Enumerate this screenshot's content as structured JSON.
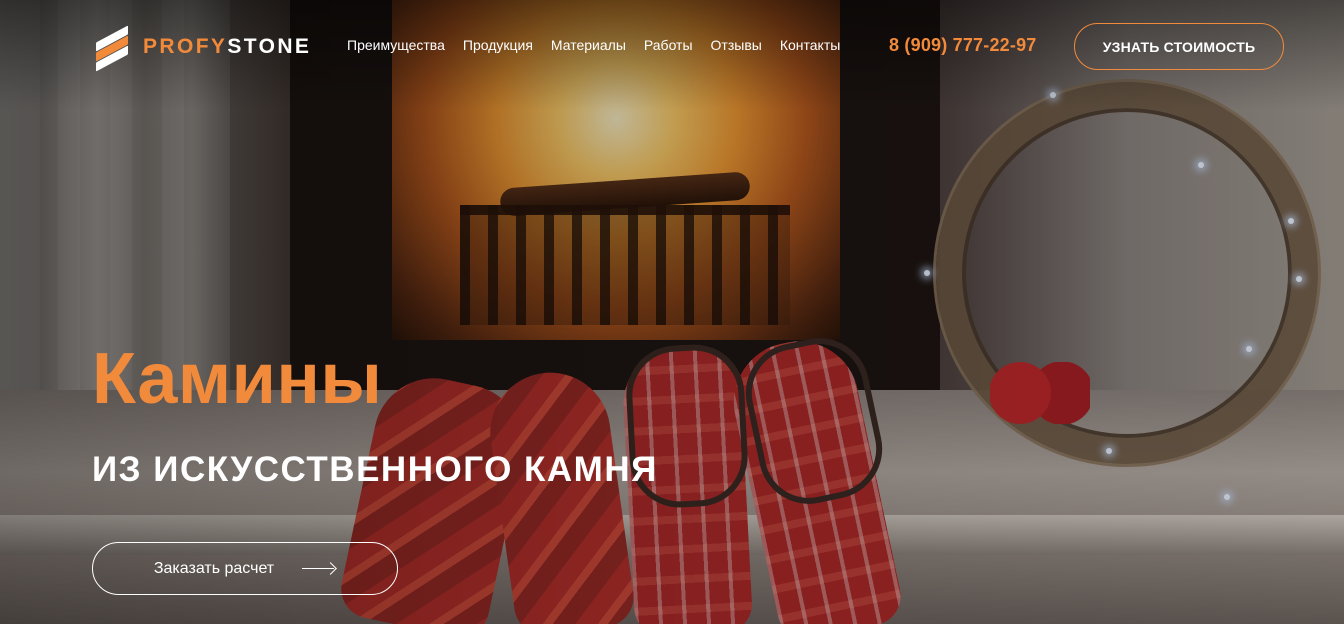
{
  "brand": {
    "name_part1": "PROFY",
    "name_part2": "STONE",
    "accent_color": "#f28a3c"
  },
  "nav": {
    "items": [
      {
        "label": "Преимущества"
      },
      {
        "label": "Продукция"
      },
      {
        "label": "Материалы"
      },
      {
        "label": "Работы"
      },
      {
        "label": "Отзывы"
      },
      {
        "label": "Контакты"
      }
    ]
  },
  "header": {
    "phone": "8 (909) 777-22-97",
    "cta_label": "УЗНАТЬ СТОИМОСТЬ"
  },
  "hero": {
    "title": "Камины",
    "subtitle": "ИЗ ИСКУССТВЕННОГО КАМНЯ",
    "cta_label": "Заказать расчет",
    "cta_icon": "arrow-right-icon",
    "background": "fireplace-socks-photo"
  }
}
